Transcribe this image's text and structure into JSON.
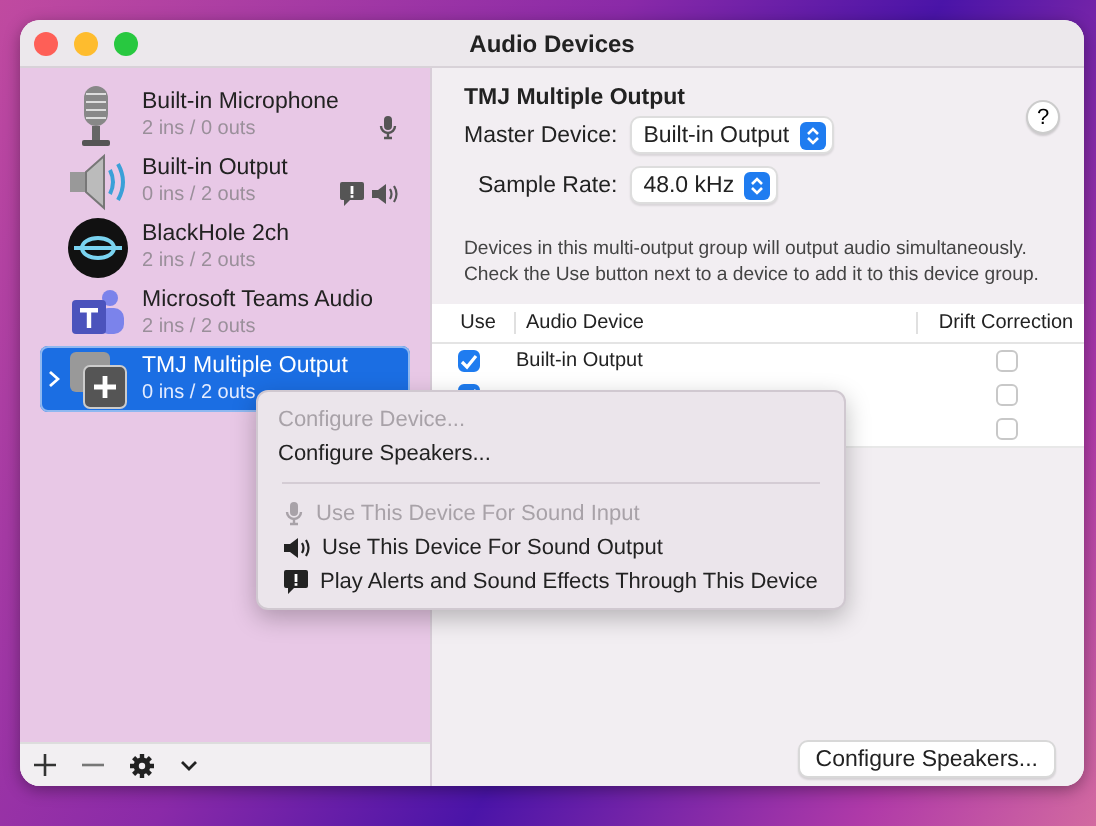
{
  "window": {
    "title": "Audio Devices"
  },
  "sidebar": {
    "items": [
      {
        "name": "Built-in Microphone",
        "channels": "2 ins / 0 outs",
        "selected": false,
        "expandable": false,
        "default_input": true,
        "default_output": false,
        "default_alerts": false
      },
      {
        "name": "Built-in Output",
        "channels": "0 ins / 2 outs",
        "selected": false,
        "expandable": false,
        "default_input": false,
        "default_output": true,
        "default_alerts": true
      },
      {
        "name": "BlackHole 2ch",
        "channels": "2 ins / 2 outs",
        "selected": false,
        "expandable": false,
        "default_input": false,
        "default_output": false,
        "default_alerts": false
      },
      {
        "name": "Microsoft Teams Audio",
        "channels": "2 ins / 2 outs",
        "selected": false,
        "expandable": false,
        "default_input": false,
        "default_output": false,
        "default_alerts": false
      },
      {
        "name": "TMJ Multiple Output",
        "channels": "0 ins / 2 outs",
        "selected": true,
        "expandable": true,
        "default_input": false,
        "default_output": false,
        "default_alerts": false
      }
    ]
  },
  "detail": {
    "title": "TMJ Multiple Output",
    "help": "?",
    "fields": [
      {
        "label": "Master Device:",
        "value": "Built-in Output"
      },
      {
        "label": "Sample Rate:",
        "value": "48.0 kHz"
      }
    ],
    "description": "Devices in this multi-output group will output audio simultaneously. Check the Use button next to a device to add it to this device group.",
    "table": {
      "columns": [
        "Use",
        "Audio Device",
        "Drift Correction"
      ],
      "rows": [
        {
          "use": true,
          "device": "Built-in Output",
          "drift_correction": false
        },
        {
          "use": true,
          "drift_correction": false
        },
        {
          "drift_correction": false
        }
      ]
    },
    "button": "Configure Speakers..."
  },
  "context_menu": [
    {
      "kind": "item",
      "label": "Configure Device...",
      "disabled": true
    },
    {
      "kind": "item",
      "label": "Configure Speakers...",
      "disabled": false
    },
    {
      "kind": "separator"
    },
    {
      "kind": "item",
      "label": "Use This Device For Sound Input",
      "disabled": true
    },
    {
      "kind": "item",
      "label": "Use This Device For Sound Output",
      "disabled": false
    },
    {
      "kind": "item",
      "label": "Play Alerts and Sound Effects Through This Device",
      "disabled": false
    }
  ]
}
